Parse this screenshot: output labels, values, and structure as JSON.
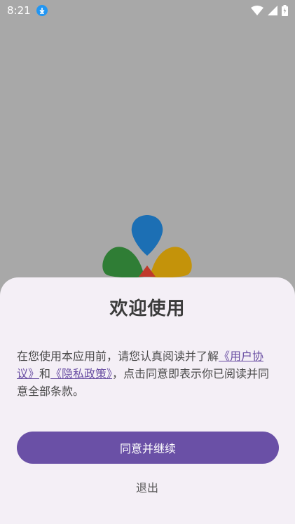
{
  "status_bar": {
    "time": "8:21",
    "icons": [
      "download-icon",
      "wifi-icon",
      "signal-icon",
      "battery-icon"
    ]
  },
  "dialog": {
    "title": "欢迎使用",
    "text_1": "在您使用本应用前，请您认真阅读并了解",
    "link_user_agreement": "《用户协议》",
    "text_2": "和",
    "link_privacy_policy": "《隐私政策》",
    "text_3": "，点击同意即表示你已阅读并同意全部条款。",
    "agree_label": "同意并继续",
    "exit_label": "退出"
  },
  "colors": {
    "scrim": "#a8a8a8",
    "sheet_bg": "#f4eff6",
    "primary": "#6a50a6",
    "link": "#6a4fa3",
    "logo_blue": "#1c6fb4",
    "logo_green": "#2f7d35",
    "logo_yellow": "#c4930a",
    "logo_red": "#c0392b"
  }
}
